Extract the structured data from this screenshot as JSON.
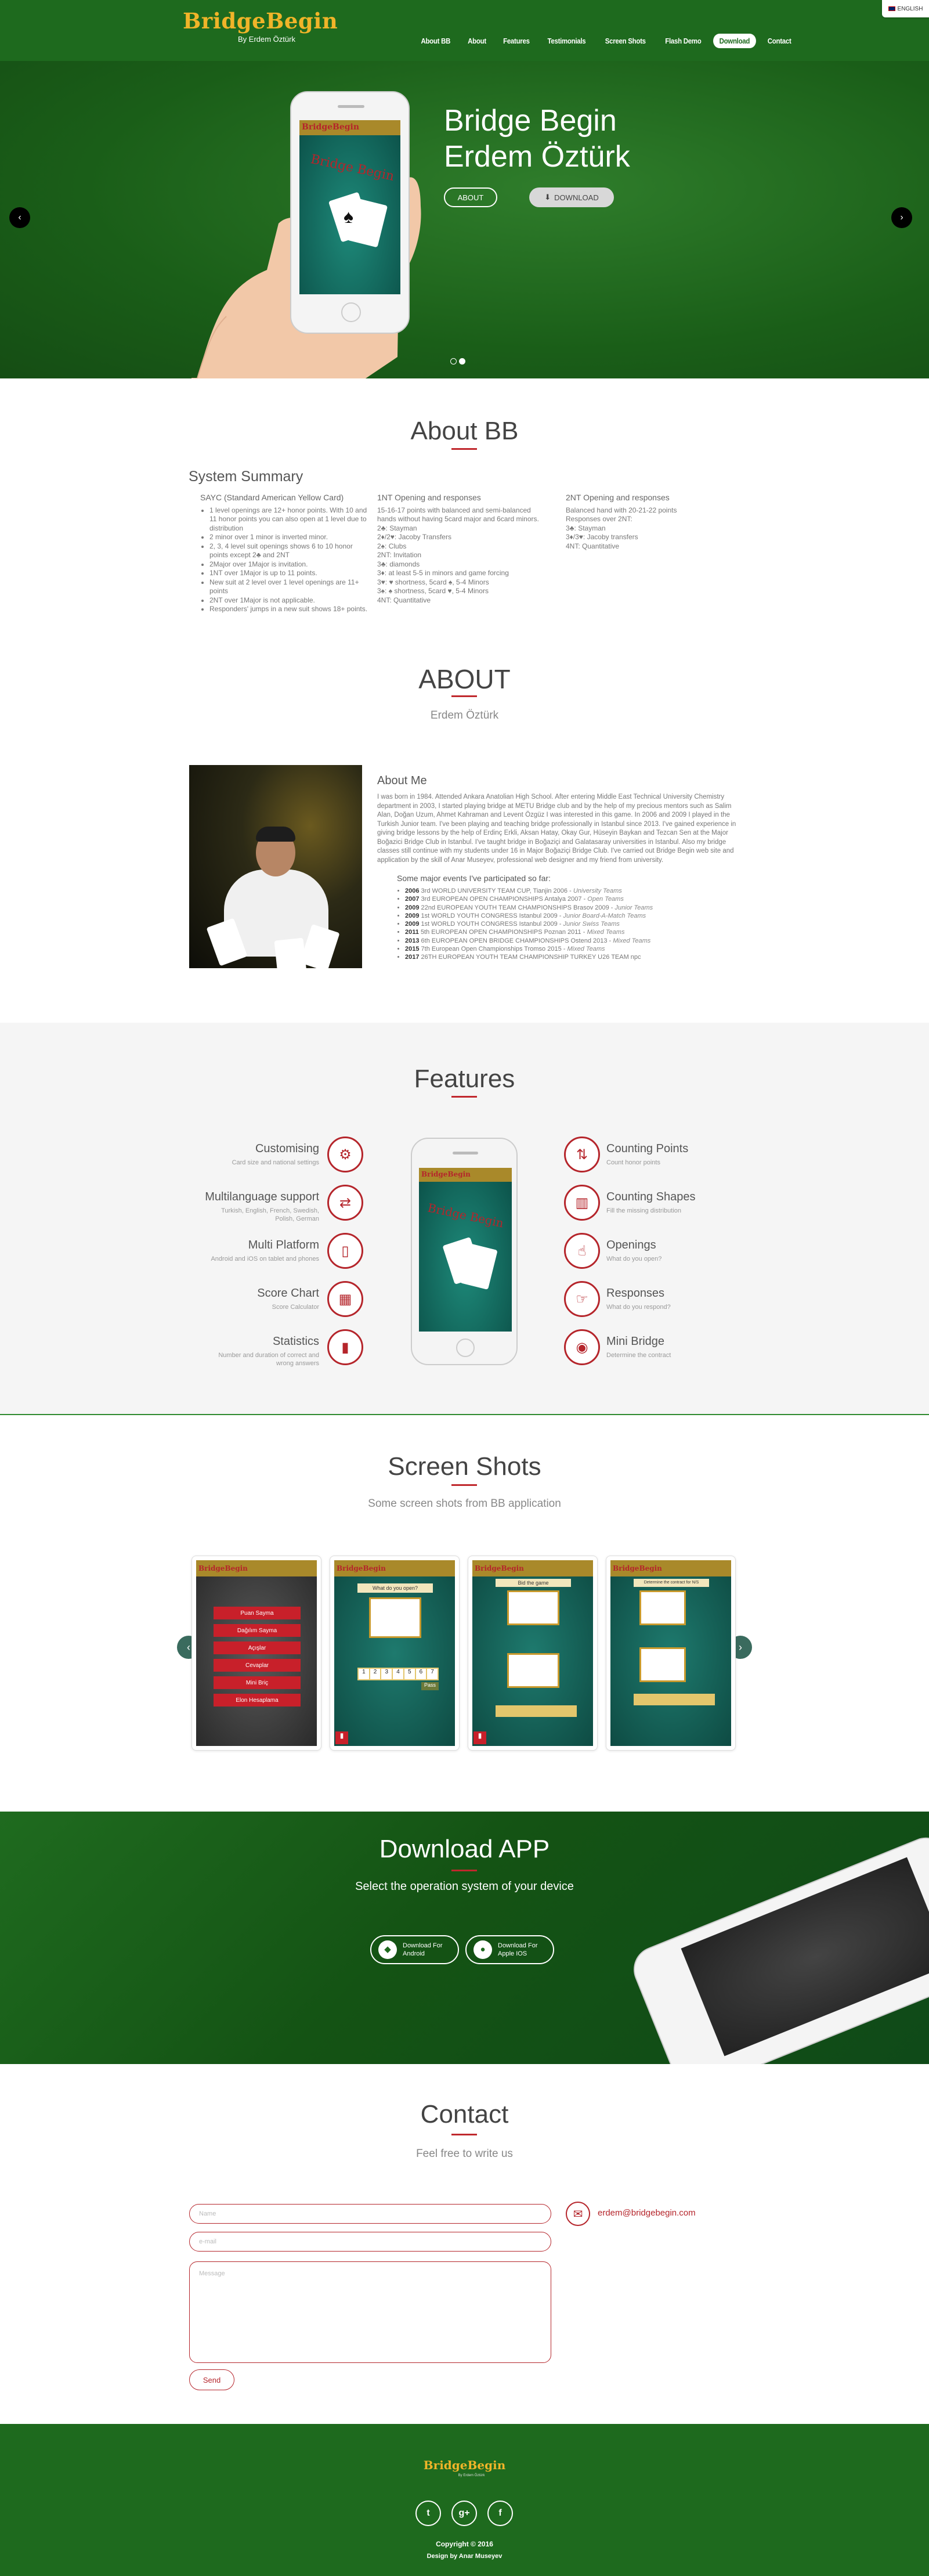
{
  "header": {
    "logo": "BridgeBegin",
    "logo_sub": "By Erdem Öztürk",
    "nav": [
      "About BB",
      "About",
      "Features",
      "Testimonials",
      "Screen Shots",
      "Flash Demo",
      "Download",
      "Contact"
    ],
    "language": "ENGLISH"
  },
  "hero": {
    "title_line1": "Bridge Begin",
    "title_line2": "Erdem Öztürk",
    "about_label": "ABOUT",
    "download_label": "DOWNLOAD",
    "phone_logo": "BridgeBegin",
    "phone_watermark": "Bridge Begin"
  },
  "about_bb": {
    "title": "About BB",
    "system_summary": "System Summary",
    "col1_title": "SAYC (Standard American Yellow Card)",
    "col1_items": [
      "1 level openings are 12+ honor points. With 10 and 11 honor points you can also open at 1 level due to distribution",
      "2 minor over 1 minor is inverted minor.",
      "2, 3, 4 level suit openings shows 6 to 10 honor points except 2♣ and 2NT",
      "2Major over 1Major is invitation.",
      "1NT over 1Major is up to 11 points.",
      "New suit at 2 level over 1 level openings are 11+ points",
      "2NT over 1Major is not applicable.",
      "Responders' jumps in a new suit shows 18+ points."
    ],
    "col2_title": "1NT Opening and responses",
    "col2_lines": [
      "15-16-17 points with balanced and semi-balanced hands without having 5card major and 6card minors.",
      "2♣: Stayman",
      "2♦/2♥: Jacoby Transfers",
      "2♠: Clubs",
      "2NT: Invitation",
      "3♣: diamonds",
      "3♦: at least 5-5 in minors and game forcing",
      "3♥: ♥ shortness, 5card ♠, 5-4 Minors",
      "3♠: ♠ shortness, 5card ♥, 5-4 Minors",
      "4NT: Quantitative"
    ],
    "col3_title": "2NT Opening and responses",
    "col3_lines": [
      "Balanced hand with 20-21-22 points",
      "Responses over 2NT:",
      "3♣: Stayman",
      "3♦/3♥: Jacoby transfers",
      "4NT: Quantitative"
    ]
  },
  "about": {
    "title": "ABOUT",
    "subtitle": "Erdem Öztürk",
    "about_me_title": "About Me",
    "about_me_text": "I was born in 1984. Attended Ankara Anatolian High School. After entering Middle East Technical University Chemistry department in 2003, I started playing bridge at METU Bridge club and by the help of my precious mentors such as Salim Alan, Doğan Uzum, Ahmet Kahraman and Levent Özgüz I was interested in this game. In 2006 and 2009 I played in the Turkish Junior team. I've been playing and teaching bridge professionally in Istanbul since 2013. I've gained experience in giving bridge lessons by the help of Erdinç Erkli, Aksan Hatay, Okay Gur, Hüseyin Baykan and Tezcan Sen at the Major Boğazici Bridge Club in Istanbul. I've taught bridge in Boğaziçi and Galatasaray universities in Istanbul. Also my bridge classes still continue with my students under 16 in Major Boğaziçi Bridge Club. I've carried out Bridge Begin web site and application by the skill of Anar Museyev, professional web designer and my friend from university.",
    "events_title": "Some major events I've participated so far:",
    "events": [
      {
        "year": "2006",
        "name": "3rd WORLD UNIVERSITY TEAM CUP, Tianjin 2006 - ",
        "team": "University Teams"
      },
      {
        "year": "2007",
        "name": "3rd EUROPEAN OPEN CHAMPIONSHIPS Antalya 2007 - ",
        "team": "Open Teams"
      },
      {
        "year": "2009",
        "name": "22nd EUROPEAN YOUTH TEAM CHAMPIONSHIPS Brasov 2009 - ",
        "team": "Junior Teams"
      },
      {
        "year": "2009",
        "name": "1st WORLD YOUTH CONGRESS Istanbul 2009 - ",
        "team": "Junior Board-A-Match Teams"
      },
      {
        "year": "2009",
        "name": "1st WORLD YOUTH CONGRESS Istanbul 2009 - ",
        "team": "Junior Swiss Teams"
      },
      {
        "year": "2011",
        "name": "5th EUROPEAN OPEN CHAMPIONSHIPS Poznan 2011 - ",
        "team": "Mixed Teams"
      },
      {
        "year": "2013",
        "name": "6th EUROPEAN OPEN BRIDGE CHAMPIONSHIPS Ostend 2013 - ",
        "team": "Mixed Teams"
      },
      {
        "year": "2015",
        "name": "7th European Open Championships Tromso 2015 - ",
        "team": "Mixed Teams"
      },
      {
        "year": "2017",
        "name": "26TH EUROPEAN YOUTH TEAM CHAMPIONSHIP TURKEY U26 TEAM npc",
        "team": ""
      }
    ]
  },
  "features": {
    "title": "Features",
    "left": [
      {
        "title": "Customising",
        "sub": "Card size and national settings"
      },
      {
        "title": "Multilanguage support",
        "sub": "Turkish, English, French, Swedish, Polish, German"
      },
      {
        "title": "Multi Platform",
        "sub": "Android and iOS on tablet and phones"
      },
      {
        "title": "Score Chart",
        "sub": "Score Calculator"
      },
      {
        "title": "Statistics",
        "sub": "Number and duration of correct and wrong answers"
      }
    ],
    "right": [
      {
        "title": "Counting Points",
        "sub": "Count honor points"
      },
      {
        "title": "Counting Shapes",
        "sub": "Fill the missing distribution"
      },
      {
        "title": "Openings",
        "sub": "What do you open?"
      },
      {
        "title": "Responses",
        "sub": "What do you respond?"
      },
      {
        "title": "Mini Bridge",
        "sub": "Determine the contract"
      }
    ]
  },
  "screenshots": {
    "title": "Screen Shots",
    "subtitle": "Some screen shots from BB application",
    "shot_logo": "BridgeBegin",
    "menu": [
      "Puan Sayma",
      "Dağılım Sayma",
      "Açışlar",
      "Cevaplar",
      "Mini Briç",
      "Elon Hesaplama"
    ],
    "q2": "What do you open?",
    "q3": "Bid the game",
    "q4": "Determine the contract for N/S",
    "keys": [
      "1",
      "2",
      "3",
      "4",
      "5",
      "6",
      "7"
    ],
    "pass": "Pass"
  },
  "download": {
    "title": "Download APP",
    "subtitle": "Select the operation system of your device",
    "android_line1": "Download For",
    "android_line2": "Android",
    "ios_line1": "Download For",
    "ios_line2": "Apple IOS"
  },
  "contact": {
    "title": "Contact",
    "subtitle": "Feel free to write us",
    "name_ph": "Name",
    "email_ph": "e-mail",
    "message_ph": "Message",
    "send": "Send",
    "email": "erdem@bridgebegin.com"
  },
  "footer": {
    "logo": "BridgeBegin",
    "logo_sub": "By Erdem Öztürk",
    "copyright": "Copyright © 2016",
    "design": "Design by Anar Museyev"
  }
}
